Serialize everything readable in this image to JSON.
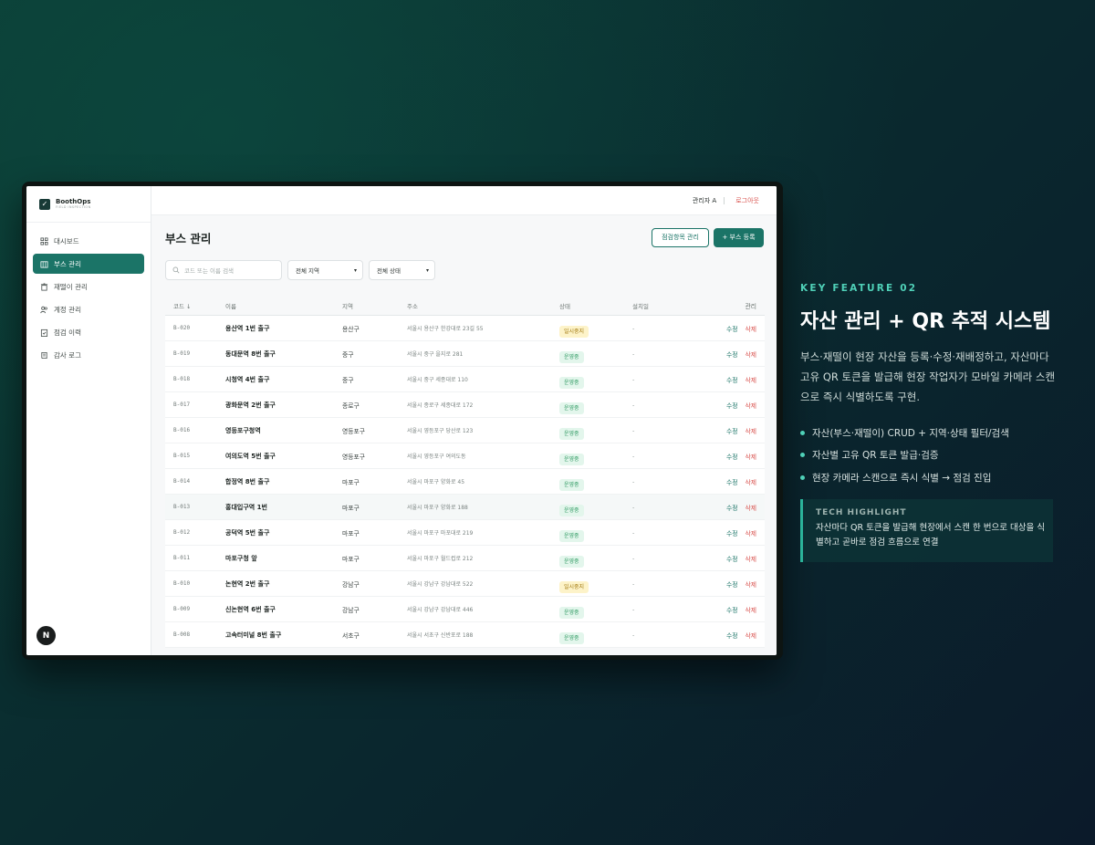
{
  "app": {
    "brand_name": "BoothOps",
    "brand_sub": "FIELD INSPECTION",
    "user": "관리자 A",
    "logout": "로그아웃",
    "nav": [
      {
        "label": "대시보드",
        "icon": "dashboard-grid-icon",
        "active": false
      },
      {
        "label": "부스 관리",
        "icon": "building-icon",
        "active": true
      },
      {
        "label": "재떨이 관리",
        "icon": "bin-icon",
        "active": false
      },
      {
        "label": "계정 관리",
        "icon": "users-icon",
        "active": false
      },
      {
        "label": "점검 이력",
        "icon": "clipboard-check-icon",
        "active": false
      },
      {
        "label": "감사 로그",
        "icon": "scroll-icon",
        "active": false
      }
    ],
    "framework_badge": "N"
  },
  "page": {
    "title": "부스 관리",
    "btn_items": "점검항목 관리",
    "btn_add": "+ 부스 등록",
    "search_placeholder": "코드 또는 이름 검색",
    "region_select": "전체 지역",
    "status_select": "전체 상태"
  },
  "table": {
    "headers": {
      "code": "코드 ↓",
      "name": "이름",
      "region": "지역",
      "address": "주소",
      "status": "상태",
      "install": "설치일",
      "manage": "관리"
    },
    "edit_label": "수정",
    "delete_label": "삭제",
    "rows": [
      {
        "code": "B-020",
        "name": "용산역 1번 출구",
        "region": "용산구",
        "address": "서울시 용산구 한강대로 23길 55",
        "status": "일시중지",
        "install": "-"
      },
      {
        "code": "B-019",
        "name": "동대문역 8번 출구",
        "region": "중구",
        "address": "서울시 중구 을지로 281",
        "status": "운영중",
        "install": "-"
      },
      {
        "code": "B-018",
        "name": "시청역 4번 출구",
        "region": "중구",
        "address": "서울시 중구 세종대로 110",
        "status": "운영중",
        "install": "-"
      },
      {
        "code": "B-017",
        "name": "광화문역 2번 출구",
        "region": "종로구",
        "address": "서울시 종로구 세종대로 172",
        "status": "운영중",
        "install": "-"
      },
      {
        "code": "B-016",
        "name": "영등포구청역",
        "region": "영등포구",
        "address": "서울시 영등포구 당산로 123",
        "status": "운영중",
        "install": "-"
      },
      {
        "code": "B-015",
        "name": "여의도역 5번 출구",
        "region": "영등포구",
        "address": "서울시 영등포구 여의도동",
        "status": "운영중",
        "install": "-"
      },
      {
        "code": "B-014",
        "name": "합정역 8번 출구",
        "region": "마포구",
        "address": "서울시 마포구 양화로 45",
        "status": "운영중",
        "install": "-"
      },
      {
        "code": "B-013",
        "name": "홍대입구역 1번",
        "region": "마포구",
        "address": "서울시 마포구 양화로 188",
        "status": "운영중",
        "install": "-"
      },
      {
        "code": "B-012",
        "name": "공덕역 5번 출구",
        "region": "마포구",
        "address": "서울시 마포구 마포대로 219",
        "status": "운영중",
        "install": "-"
      },
      {
        "code": "B-011",
        "name": "마포구청 앞",
        "region": "마포구",
        "address": "서울시 마포구 월드컵로 212",
        "status": "운영중",
        "install": "-"
      },
      {
        "code": "B-010",
        "name": "논현역 2번 출구",
        "region": "강남구",
        "address": "서울시 강남구 강남대로 522",
        "status": "일시중지",
        "install": "-"
      },
      {
        "code": "B-009",
        "name": "신논현역 6번 출구",
        "region": "강남구",
        "address": "서울시 강남구 강남대로 446",
        "status": "운영중",
        "install": "-"
      },
      {
        "code": "B-008",
        "name": "고속터미널 8번 출구",
        "region": "서초구",
        "address": "서울시 서초구 신반포로 188",
        "status": "운영중",
        "install": "-"
      }
    ]
  },
  "feature": {
    "tag": "KEY FEATURE 02",
    "title": "자산 관리 + QR 추적 시스템",
    "desc": "부스·재떨이 현장 자산을 등록·수정·재배정하고, 자산마다 고유 QR 토큰을 발급해 현장 작업자가 모바일 카메라 스캔으로 즉시 식별하도록 구현.",
    "bullets": [
      "자산(부스·재떨이) CRUD + 지역·상태 필터/검색",
      "자산별 고유 QR 토큰 발급·검증",
      "현장 카메라 스캔으로 즉시 식별 → 점검 진입"
    ],
    "highlight_title": "TECH HIGHLIGHT",
    "highlight_text": "자산마다 QR 토큰을 발급해 현장에서 스캔 한 번으로 대상을 식별하고 곧바로 점검 흐름으로 연결"
  },
  "colors": {
    "accent": "#1b7467",
    "feature_accent": "#4fd1b8",
    "status_active_bg": "#e3f6ec",
    "status_active_fg": "#2f9a62",
    "status_paused_bg": "#fdf3c9",
    "status_paused_fg": "#a27a10",
    "danger": "#d9534f"
  }
}
